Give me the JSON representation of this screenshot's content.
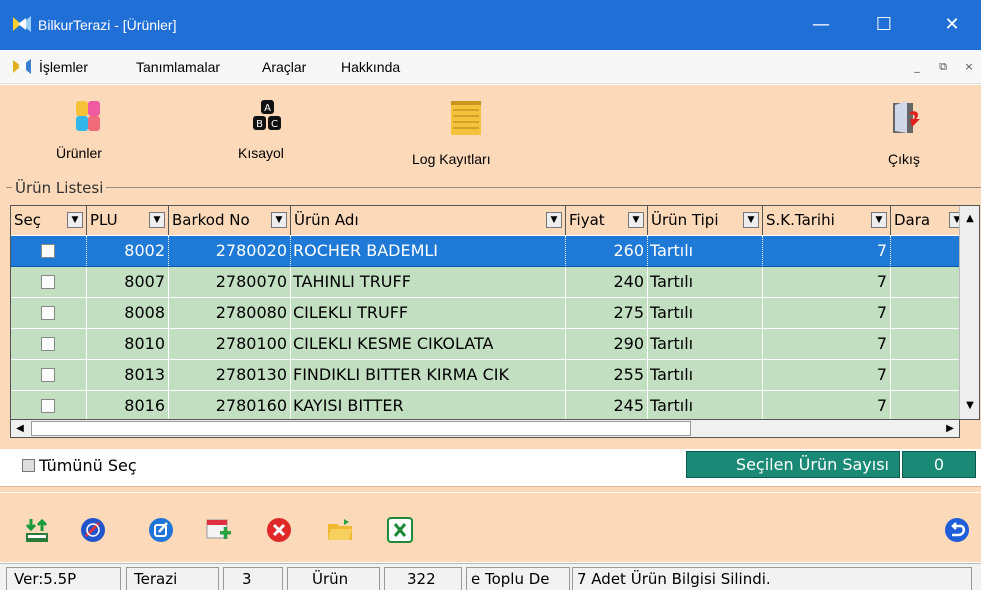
{
  "window": {
    "title": "BilkurTerazi  - [Ürünler]",
    "minimize": "—",
    "maximize": "☐",
    "close": "✕"
  },
  "menu": {
    "items": [
      "İşlemler",
      "Tanımlamalar",
      "Araçlar",
      "Hakkında"
    ],
    "mdi_min": "_",
    "mdi_restore": "⧉",
    "mdi_close": "×"
  },
  "toolbar": {
    "urunler": "Ürünler",
    "kisayol": "Kısayol",
    "log": "Log Kayıtları",
    "cikis": "Çıkış"
  },
  "group_label": "Ürün Listesi",
  "grid": {
    "headers": [
      "Seç",
      "PLU",
      "Barkod No",
      "Ürün Adı",
      "Fiyat",
      "Ürün Tipi",
      "S.K.Tarihi",
      "Dara"
    ],
    "rows": [
      {
        "plu": "8002",
        "barkod": "2780020",
        "ad": "ROCHER BADEMLI",
        "fiyat": "260",
        "tip": "Tartılı",
        "skt": "7"
      },
      {
        "plu": "8007",
        "barkod": "2780070",
        "ad": "TAHINLI TRUFF",
        "fiyat": "240",
        "tip": "Tartılı",
        "skt": "7"
      },
      {
        "plu": "8008",
        "barkod": "2780080",
        "ad": "CILEKLI TRUFF",
        "fiyat": "275",
        "tip": "Tartılı",
        "skt": "7"
      },
      {
        "plu": "8010",
        "barkod": "2780100",
        "ad": "CILEKLI KESME CIKOLATA",
        "fiyat": "290",
        "tip": "Tartılı",
        "skt": "7"
      },
      {
        "plu": "8013",
        "barkod": "2780130",
        "ad": "FINDIKLI BITTER KIRMA CIK",
        "fiyat": "255",
        "tip": "Tartılı",
        "skt": "7"
      },
      {
        "plu": "8016",
        "barkod": "2780160",
        "ad": "KAYISI BITTER",
        "fiyat": "245",
        "tip": "Tartılı",
        "skt": "7"
      }
    ]
  },
  "select_all": "Tümünü Seç",
  "selected_count_label": "Seçilen Ürün Sayısı",
  "selected_count": "0",
  "status": {
    "ver": "Ver:5.5P",
    "terazi_lbl": "Terazi",
    "terazi_val": "3",
    "urun_lbl": "Ürün",
    "urun_val": "322",
    "msg1": "e Toplu De",
    "msg2": "7 Adet Ürün Bilgisi Silindi."
  },
  "colors": {
    "titlebar": "#1f6fd6",
    "panel": "#fbd9b9",
    "row": "#c2dfc2",
    "selected": "#1e7ad6",
    "count": "#1a8a76"
  }
}
